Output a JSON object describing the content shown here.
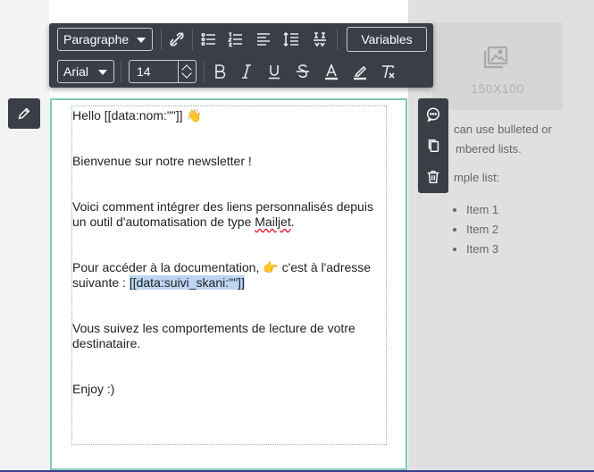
{
  "toolbar": {
    "paragraph_label": "Paragraphe",
    "font_label": "Arial",
    "size_value": "14",
    "variables_label": "Variables",
    "row1_icons": [
      "unlink-icon",
      "bulleted-list-icon",
      "numbered-list-icon",
      "align-left-icon",
      "line-height-icon",
      "merge-tag-icon"
    ],
    "row2_icons": [
      "bold-icon",
      "italic-icon",
      "underline-icon",
      "strikethrough-icon",
      "text-color-icon",
      "highlight-icon",
      "clear-format-icon"
    ]
  },
  "content": {
    "greeting": "Hello [[data:nom:\"\"]] ",
    "greeting_emoji": "👋",
    "welcome": "Bienvenue sur notre newsletter !",
    "intro_before": "Voici comment intégrer des liens personnalisés depuis un outil d'automatisation de type ",
    "intro_word": "Mailjet",
    "intro_after": ".",
    "doc_line1": "Pour accéder à la documentation, ",
    "doc_emoji": "👉",
    "doc_line1_after": " c'est à l'adresse",
    "doc_line2": "suivante : ",
    "doc_link": "[[data:suivi_skani:\"\"]]",
    "tracking": "Vous suivez les comportements de lecture de votre destinataire.",
    "enjoy": "Enjoy :)"
  },
  "sidebar": {
    "image_label": "150X100",
    "text_line1": "can use bulleted or",
    "text_line2": "mbered lists.",
    "example_label": "mple list:",
    "items": [
      "Item 1",
      "Item 2",
      "Item 3"
    ]
  },
  "colors": {
    "toolbar_bg": "#3a3e47",
    "frame_border": "#7fcbb4",
    "selection": "#bcd5f3"
  }
}
